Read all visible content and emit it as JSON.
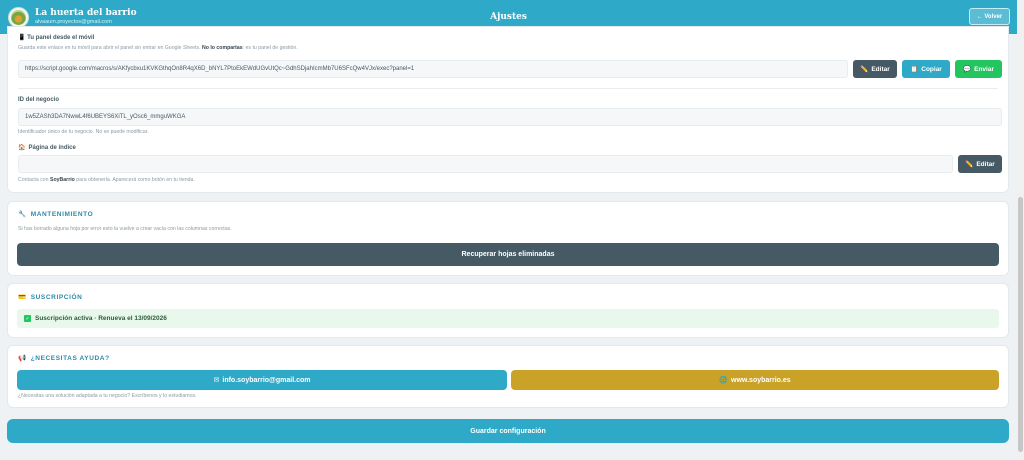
{
  "header": {
    "business_name": "La huerta del barrio",
    "email": "alvaaum.proyectos@gmail.com",
    "title": "Ajustes",
    "back_label": "← Volver"
  },
  "panel": {
    "label": "📱 Tu panel desde el móvil",
    "hint_pre": "Guarda este enlace en tu móvil para abrir el panel sin entrar en Google Sheets.",
    "hint_bold": "No lo compartas",
    "hint_post": ": es tu panel de gestión.",
    "url": "https://script.google.com/macros/s/AKfycbxu1KVKGthqOn8R4qX6D_bNYL7PtoEkEWdUGvUtQc~GdhSDjahIcmMb7U6SFcQw4VJx/exec?panel=1",
    "edit_label": "Editar",
    "copy_label": "Copiar",
    "send_label": "Enviar"
  },
  "business_id": {
    "label": "ID del negocio",
    "value": "1w5ZASh3DA7NwwL4f6UBEYS6XiTL_yOsc6_mmguWKGA",
    "hint": "Identificador único de tu negocio. No se puede modificar."
  },
  "index_page": {
    "label": "Página de índice",
    "value": "",
    "edit_label": "Editar",
    "hint_pre": "Contacta con",
    "hint_bold": "SoyBarrio",
    "hint_post": "para obtenerla. Aparecerá como botón en tu tienda."
  },
  "maintenance": {
    "title": "MANTENIMIENTO",
    "hint": "Si has borrado alguna hoja por error esto la vuelve a crear vacía con las columnas correctas.",
    "button_label": "Recuperar hojas eliminadas"
  },
  "subscription": {
    "title": "SUSCRIPCIÓN",
    "status": "Suscripción activa · Renueva el 13/09/2026"
  },
  "help": {
    "title": "¿NECESITAS AYUDA?",
    "email_label": "info.soybarrio@gmail.com",
    "web_label": "www.soybarrio.es",
    "hint": "¿Necesitas una solución adaptada a tu negocio? Escríbenos y lo estudiamos."
  },
  "save_label": "Guardar configuración",
  "colors": {
    "primary": "#2eaac8",
    "dark": "#455a64",
    "green": "#22c55e",
    "gold": "#c9a227",
    "success_bg": "#e8f8ec"
  },
  "icons": {
    "edit": "pencil-icon",
    "copy": "clipboard-icon",
    "send": "chat-icon",
    "maintenance": "wrench-icon",
    "subscription": "card-icon",
    "help": "megaphone-icon",
    "email": "envelope-icon",
    "web": "globe-icon"
  }
}
